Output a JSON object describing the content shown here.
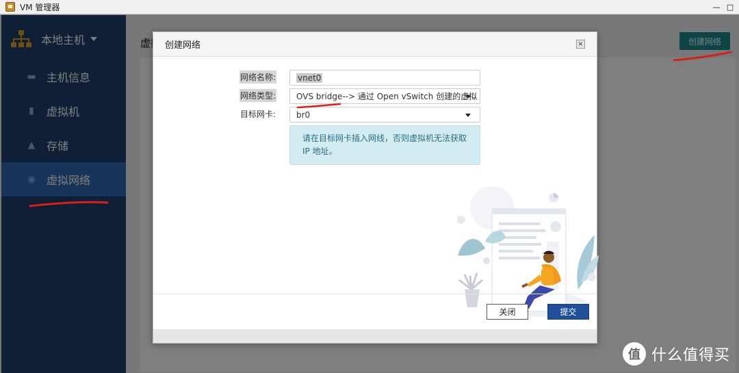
{
  "window": {
    "title": "VM 管理器",
    "controls": [
      "—",
      "□"
    ]
  },
  "sidebar": {
    "host_label": "本地主机",
    "items": [
      {
        "label": "主机信息",
        "icon": "monitor-icon"
      },
      {
        "label": "虚拟机",
        "icon": "server-icon"
      },
      {
        "label": "存储",
        "icon": "storage-icon"
      },
      {
        "label": "虚拟网络",
        "icon": "network-icon",
        "active": true
      }
    ]
  },
  "main": {
    "title": "虚拟",
    "create_button": "创建网络"
  },
  "modal": {
    "title": "创建网络",
    "close_symbol": "×",
    "fields": {
      "name_label": "网络名称:",
      "name_value": "vnet0",
      "type_label": "网络类型:",
      "type_value_highlight": "OVS bridge",
      "type_value_rest": " --> 通过 Open vSwitch 创建的虚拟",
      "nic_label": "目标网卡:",
      "nic_value": "br0"
    },
    "info_text": "请在目标网卡插入网线，否则虚拟机无法获取IP 地址。",
    "buttons": {
      "close": "关闭",
      "submit": "提交"
    }
  },
  "watermark": {
    "logo": "值",
    "text": "什么值得买"
  },
  "colors": {
    "sidebar": "#1f3f6d",
    "active": "#2f66ae",
    "accent": "#1a8a8f",
    "submit": "#1f4f9b",
    "annotation": "#d8201b"
  }
}
